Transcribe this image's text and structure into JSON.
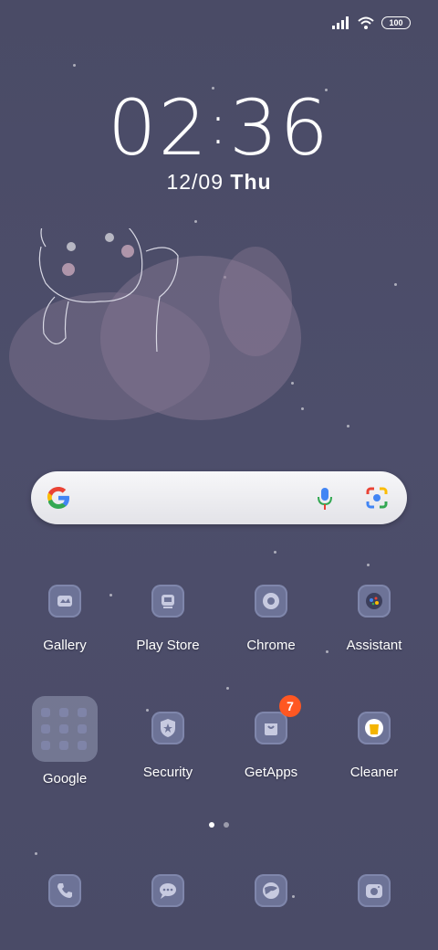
{
  "status": {
    "battery": "100"
  },
  "clock": {
    "hours": "02",
    "minutes": "36"
  },
  "date": {
    "day": "12/09",
    "weekday": "Thu"
  },
  "search": {
    "icons": [
      "google-g",
      "microphone",
      "camera-lens"
    ]
  },
  "apps_row1": [
    {
      "label": "Gallery",
      "icon": "gallery"
    },
    {
      "label": "Play Store",
      "icon": "play-store"
    },
    {
      "label": "Chrome",
      "icon": "chrome"
    },
    {
      "label": "Assistant",
      "icon": "assistant"
    }
  ],
  "apps_row2": [
    {
      "label": "Google",
      "icon": "folder"
    },
    {
      "label": "Security",
      "icon": "security"
    },
    {
      "label": "GetApps",
      "icon": "getapps",
      "badge": "7"
    },
    {
      "label": "Cleaner",
      "icon": "cleaner"
    }
  ],
  "dock": [
    {
      "icon": "phone"
    },
    {
      "icon": "messages"
    },
    {
      "icon": "browser"
    },
    {
      "icon": "camera"
    }
  ],
  "colors": {
    "accent_badge": "#ff5722",
    "background": "#4b4c68",
    "icon_tile": "#6d7397"
  }
}
